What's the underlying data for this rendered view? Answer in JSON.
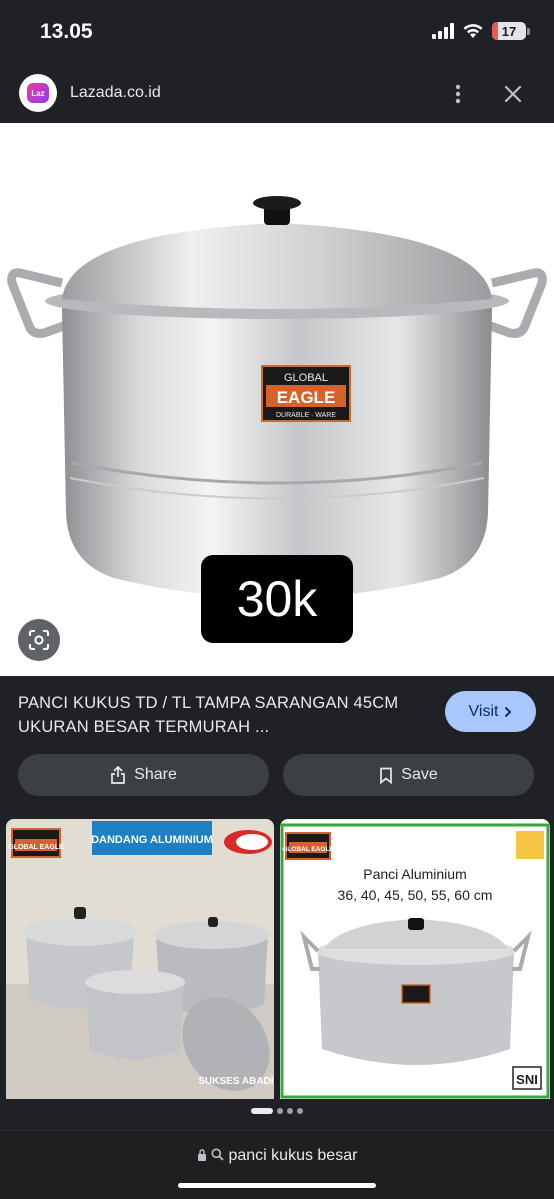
{
  "status_bar": {
    "time": "13.05",
    "battery_level": "17",
    "battery_fraction": 0.17
  },
  "header": {
    "site_name": "Lazada.co.id",
    "logo_text": "Laz"
  },
  "hero": {
    "price_label": "30k",
    "pot_label_line1": "GLOBAL",
    "pot_label_line2": "EAGLE",
    "pot_label_line3": "DURABLE · WARE"
  },
  "product": {
    "title": "PANCI KUKUS TD / TL TAMPA SARANGAN 45CM UKURAN BESAR TERMURAH ...",
    "visit_label": "Visit"
  },
  "actions": {
    "share_label": "Share",
    "save_label": "Save"
  },
  "related": [
    {
      "banner": "DANDANG ALUMINIUM",
      "brand": "GLOBAL EAGLE",
      "watermark": "SUKSES ABADI"
    },
    {
      "brand": "GLOBAL EAGLE",
      "caption_line1": "Panci Aluminium",
      "caption_line2": "36, 40, 45, 50, 55, 60 cm",
      "mark": "SNI"
    }
  ],
  "pager": {
    "total": 4,
    "active": 0
  },
  "url_bar": {
    "query": "panci kukus besar"
  },
  "colors": {
    "background": "#202124",
    "visit_button": "#a8c7fa",
    "action_button": "#3c4043",
    "battery_low": "#e35b5b"
  }
}
